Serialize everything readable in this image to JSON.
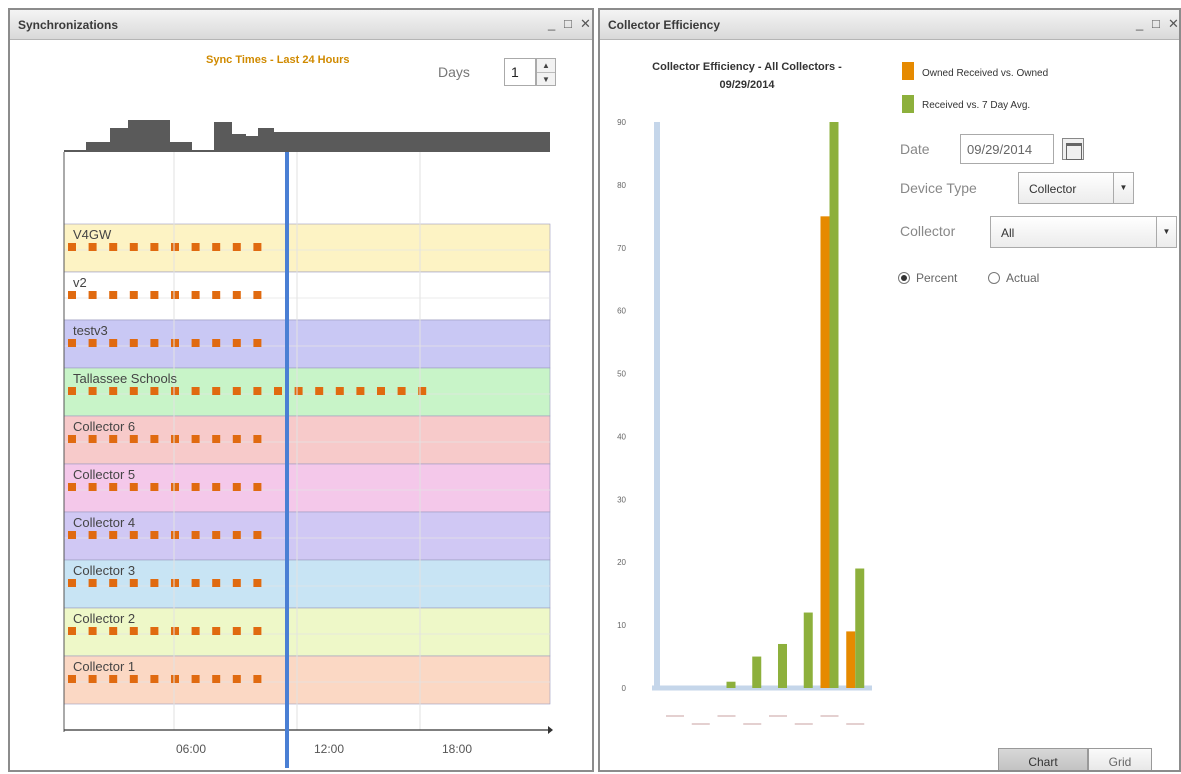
{
  "sync_panel": {
    "title": "Synchronizations",
    "caption": "Sync Times - Last 24 Hours",
    "days_label": "Days",
    "days_value": "1",
    "lanes": [
      {
        "label": "V4GW",
        "color": "#fdf3c4",
        "squares": 10
      },
      {
        "label": "v2",
        "color": "#ffffff",
        "squares": 10
      },
      {
        "label": "testv3",
        "color": "#c9c8f4",
        "squares": 10
      },
      {
        "label": "Tallassee Schools",
        "color": "#c8f4c8",
        "squares": 18
      },
      {
        "label": "Collector 6",
        "color": "#f7caca",
        "squares": 10
      },
      {
        "label": "Collector 5",
        "color": "#f4c8ea",
        "squares": 10
      },
      {
        "label": "Collector 4",
        "color": "#d0c8f4",
        "squares": 10
      },
      {
        "label": "Collector 3",
        "color": "#c8e4f4",
        "squares": 10
      },
      {
        "label": "Collector 2",
        "color": "#eef8c8",
        "squares": 10
      },
      {
        "label": "Collector 1",
        "color": "#fbd8c4",
        "squares": 10
      }
    ],
    "time_ticks": [
      "06:00",
      "12:00",
      "18:00"
    ],
    "current_time_marker_color": "#4a7fd4",
    "square_color": "#e06a10",
    "histogram_color": "#5a5a5a"
  },
  "efficiency_panel": {
    "title": "Collector Efficiency",
    "chart_title_line1": "Collector Efficiency - All Collectors -",
    "chart_title_line2": "09/29/2014",
    "legend": [
      {
        "label": "Owned Received vs. Owned",
        "color": "#e68a00"
      },
      {
        "label": "Received vs. 7 Day Avg.",
        "color": "#8db03c"
      }
    ],
    "date_label": "Date",
    "date_value": "09/29/2014",
    "device_type_label": "Device Type",
    "device_type_value": "Collector",
    "collector_label": "Collector",
    "collector_value": "All",
    "radio_percent": "Percent",
    "radio_actual": "Actual",
    "btn_chart": "Chart",
    "btn_grid": "Grid"
  },
  "chart_data": {
    "type": "bar",
    "title": "Collector Efficiency - All Collectors - 09/29/2014",
    "ylim": [
      0,
      90
    ],
    "yticks": [
      0,
      10,
      20,
      30,
      40,
      50,
      60,
      70,
      80,
      90
    ],
    "series": [
      {
        "name": "Owned Received vs. Owned",
        "color": "#e68a00",
        "values": [
          0,
          0,
          0,
          0,
          0,
          0,
          75,
          9
        ]
      },
      {
        "name": "Received vs. 7 Day Avg.",
        "color": "#8db03c",
        "values": [
          0,
          0,
          1,
          5,
          7,
          12,
          90,
          19
        ]
      }
    ],
    "highlight_bar": {
      "value": 90,
      "color": "#c5d6ea"
    }
  }
}
